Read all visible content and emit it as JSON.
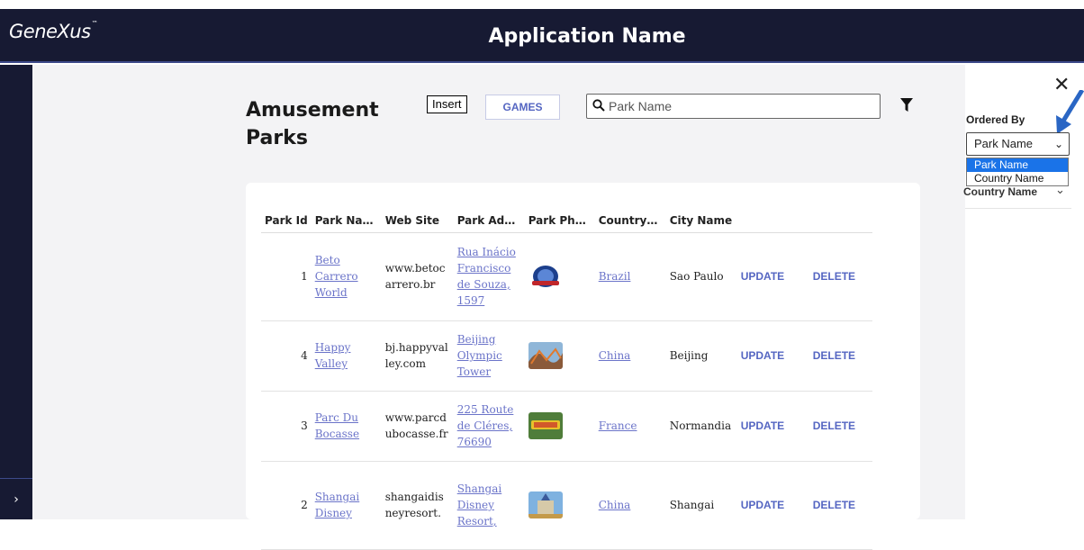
{
  "header": {
    "logo": "GeneXus",
    "logo_tm": "™",
    "app_title": "Application Name"
  },
  "sidebar": {
    "toggle_icon": "chevron-right-icon",
    "toggle_glyph": "›"
  },
  "page": {
    "title": "Amusement Parks"
  },
  "toolbar": {
    "insert_label": "Insert",
    "games_label": "GAMES",
    "search_placeholder": "Park Name",
    "search_value": "",
    "filter_icon": "filter-icon"
  },
  "table": {
    "columns": [
      "Park Id",
      "Park Na…",
      "Web Site",
      "Park Ad…",
      "Park Ph…",
      "Country…",
      "City Name"
    ],
    "rows": [
      {
        "id": "1",
        "name": "Beto Carrero World",
        "website": "www.betocarrero.br",
        "address": "Rua Inácio Francisco de Souza, 1597",
        "photo": "beto-carrero-logo",
        "country": "Brazil",
        "city": "Sao Paulo",
        "update": "UPDATE",
        "delete": "DELETE"
      },
      {
        "id": "4",
        "name": "Happy Valley",
        "website": "bj.happyvalley.com",
        "address": "Beijing Olympic Tower",
        "photo": "roller-coaster-photo",
        "country": "China",
        "city": "Beijing",
        "update": "UPDATE",
        "delete": "DELETE"
      },
      {
        "id": "3",
        "name": "Parc Du Bocasse",
        "website": "www.parcdubocasse.fr",
        "address": "225 Route de Cléres, 76690",
        "photo": "bocasse-sign-photo",
        "country": "France",
        "city": "Normandia",
        "update": "UPDATE",
        "delete": "DELETE"
      },
      {
        "id": "2",
        "name": "Shangai Disney",
        "website": "shangaidisneyresort.",
        "address": "Shangai Disney Resort,",
        "photo": "disney-castle-photo",
        "country": "China",
        "city": "Shangai",
        "update": "UPDATE",
        "delete": "DELETE"
      }
    ]
  },
  "order_panel": {
    "close_glyph": "✕",
    "label": "Ordered By",
    "selected": "Park Name",
    "options": [
      "Park Name",
      "Country Name"
    ],
    "behind_label": "Country Name"
  },
  "colors": {
    "header_bg": "#171a33",
    "accent": "#5566c2",
    "link": "#6b74c9",
    "highlight": "#1a73e8"
  }
}
